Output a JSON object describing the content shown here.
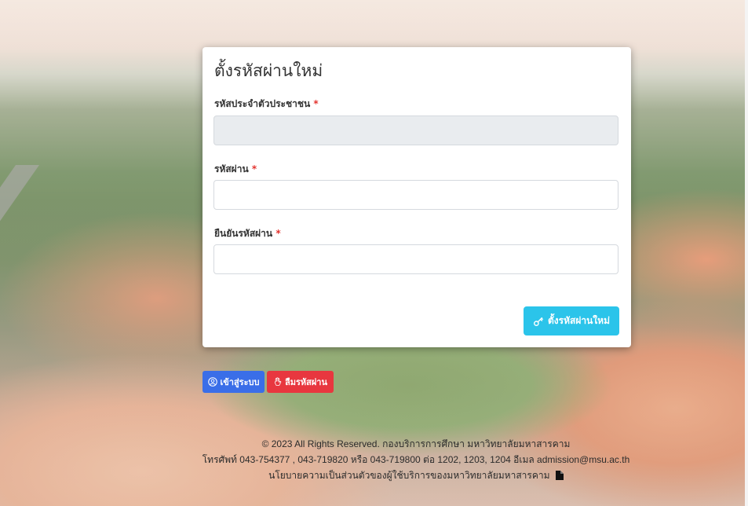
{
  "form": {
    "title": "ตั้งรหัสผ่านใหม่",
    "id_card": {
      "label": "รหัสประจำตัวประชาชน",
      "value": ""
    },
    "password": {
      "label": "รหัสผ่าน",
      "value": ""
    },
    "confirm_password": {
      "label": "ยืนยันรหัสผ่าน",
      "value": ""
    },
    "required_mark": "*",
    "submit_label": "ตั้งรหัสผ่านใหม่"
  },
  "buttons": {
    "login_label": "เข้าสู่ระบบ",
    "forgot_label": "ลืมรหัสผ่าน"
  },
  "footer": {
    "copyright": "© 2023 All Rights Reserved. กองบริการการศึกษา มหาวิทยาลัยมหาสารคาม",
    "contact": "โทรศัพท์ 043-754377 , 043-719820 หรือ 043-719800 ต่อ 1202, 1203, 1204 อีเมล admission@msu.ac.th",
    "privacy_link": "นโยบายความเป็นส่วนตัวของผู้ใช้บริการของมหาวิทยาลัยมหาสารคาม"
  },
  "colors": {
    "submit_button": "#2bc4ea",
    "login_button": "#3a6ee8",
    "forgot_button": "#e8373f",
    "required": "#e3342f"
  },
  "icons": {
    "submit": "key-icon",
    "login": "user-circle-icon",
    "forgot": "hand-icon",
    "privacy": "file-icon"
  }
}
